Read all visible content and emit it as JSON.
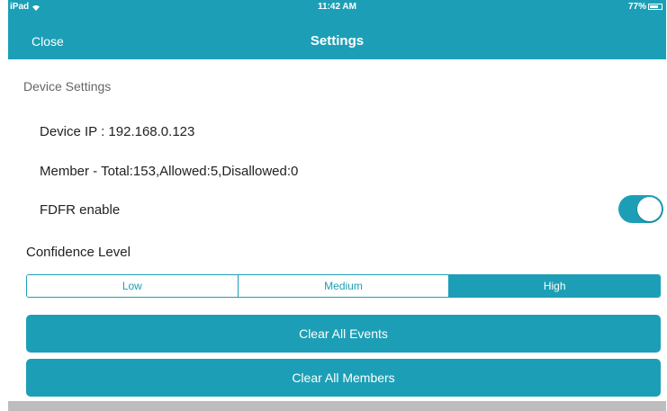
{
  "status_bar": {
    "carrier": "iPad",
    "time": "11:42 AM",
    "battery": "77%",
    "battery_level": 0.77
  },
  "navbar": {
    "close_label": "Close",
    "title": "Settings"
  },
  "section": {
    "title": "Device Settings"
  },
  "device": {
    "ip_text": "Device IP : 192.168.0.123",
    "member_text": "Member - Total:153,Allowed:5,Disallowed:0"
  },
  "fdfr": {
    "label": "FDFR enable",
    "enabled": true
  },
  "confidence": {
    "label": "Confidence Level",
    "options": [
      "Low",
      "Medium",
      "High"
    ],
    "selected": "High"
  },
  "actions": {
    "clear_events": "Clear All Events",
    "clear_members": "Clear All Members"
  },
  "colors": {
    "accent": "#1c9fb6"
  }
}
